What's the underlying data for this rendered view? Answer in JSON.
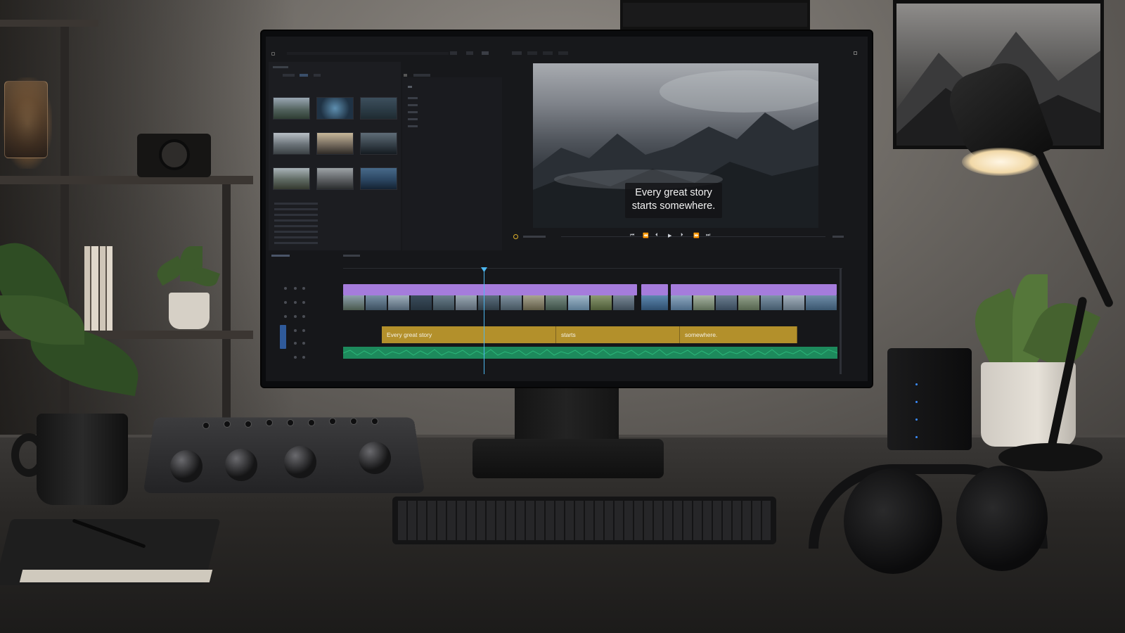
{
  "viewer": {
    "subtitle_line1": "Every great story",
    "subtitle_line2": "starts somewhere."
  },
  "timeline": {
    "caption_clips": [
      {
        "label": "Every great story"
      },
      {
        "label": "starts"
      },
      {
        "label": "somewhere."
      }
    ]
  },
  "colors": {
    "video_track": "#a57cdc",
    "caption_track": "#b3902b",
    "audio_track": "#1d8a5c",
    "playhead": "#4cb7f0"
  }
}
